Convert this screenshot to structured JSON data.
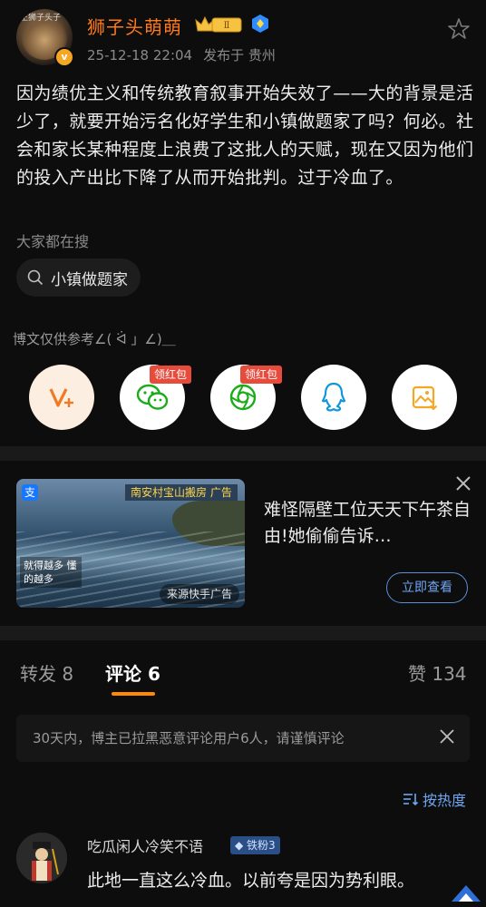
{
  "post": {
    "author": "狮子头萌萌",
    "level_badge": "Ⅱ",
    "vip_mark": "v",
    "avatar_watermark": "王狮子头子",
    "date": "25-12-18 22:04",
    "location": "发布于 贵州",
    "content": "因为绩优主义和传统教育叙事开始失效了——大的背景是活少了，就要开始污名化好学生和小镇做题家了吗？何必。社会和家长某种程度上浪费了这批人的天赋，现在又因为他们的投入产出比下降了从而开始批判。过于冷血了。",
    "search_label": "大家都在搜",
    "search_chip": "小镇做题家",
    "footnote": "博文仅供参考∠( ᐛ 」∠)＿"
  },
  "share": {
    "red_packet_label": "领红包",
    "items": [
      {
        "icon": "vplus-icon",
        "color": "#f07a22"
      },
      {
        "icon": "wechat-icon",
        "color": "#1aad19"
      },
      {
        "icon": "moments-icon",
        "color": "#1aad19"
      },
      {
        "icon": "qq-icon",
        "color": "#1296db"
      },
      {
        "icon": "save-image-icon",
        "color": "#f5a623"
      }
    ]
  },
  "ad": {
    "title": "难怪隔壁工位天天下午茶自由!她偷偷告诉…",
    "button": "立即查看",
    "image_banner": "南安村宝山搬房  广告",
    "image_side": "就得越多 懂的越多",
    "image_source": "来源快手广告",
    "image_brand": "支"
  },
  "tabs": {
    "repost": "转发 8",
    "comments": "评论 6",
    "likes": "赞 134"
  },
  "notice": "30天内，博主已拉黑恶意评论用户6人，请谨慎评论",
  "sort_label": "按热度",
  "comment": {
    "author": "吃瓜闲人冷笑不语",
    "badge": "铁粉3",
    "text": "此地一直这么冷血。以前夸是因为势利眼。"
  },
  "colors": {
    "accent_orange": "#ff8a00",
    "username_orange": "#ff7a1a",
    "link_blue": "#6ea6f4",
    "background": "#0d0d0d"
  }
}
